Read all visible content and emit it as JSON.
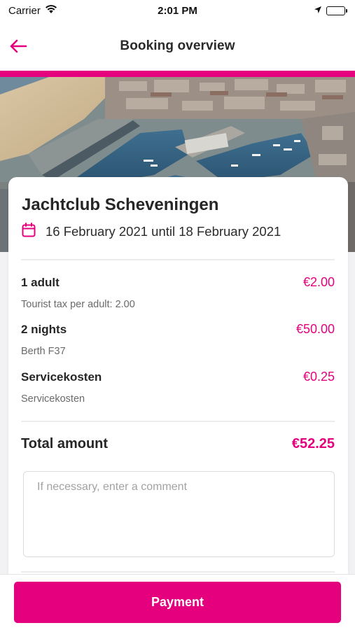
{
  "status_bar": {
    "carrier": "Carrier",
    "time": "2:01 PM"
  },
  "nav": {
    "title": "Booking overview",
    "back_icon": "arrow-left-icon"
  },
  "colors": {
    "accent": "#e5007e",
    "text": "#262626",
    "muted": "#6a6a6a"
  },
  "booking": {
    "name": "Jachtclub Scheveningen",
    "date_icon": "calendar-icon",
    "dates": "16 February 2021 until 18 February 2021",
    "items": [
      {
        "title": "1 adult",
        "price": "€2.00",
        "subtitle": "Tourist tax per adult: 2.00"
      },
      {
        "title": "2 nights",
        "price": "€50.00",
        "subtitle": "Berth F37"
      },
      {
        "title": "Servicekosten",
        "price": "€0.25",
        "subtitle": "Servicekosten"
      }
    ],
    "total_label": "Total amount",
    "total_value": "€52.25",
    "comment_placeholder": "If necessary, enter a comment"
  },
  "actions": {
    "payment_label": "Payment"
  }
}
